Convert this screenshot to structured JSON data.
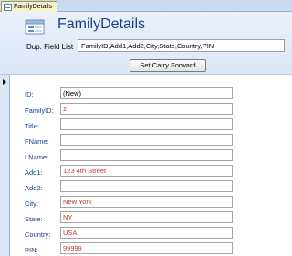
{
  "tab": {
    "label": "FamilyDetails"
  },
  "form": {
    "title": "FamilyDetails"
  },
  "dup_field": {
    "label": "Dup. Field List",
    "value": "FamilyID,Add1,Add2,City,State,Country,PIN"
  },
  "buttons": {
    "carry_forward": "Set Carry Forward"
  },
  "fields": [
    {
      "label": "ID:",
      "value": "(New)"
    },
    {
      "label": "FamilyID:",
      "value": "2"
    },
    {
      "label": "Title:",
      "value": ""
    },
    {
      "label": "FName:",
      "value": ""
    },
    {
      "label": "LName:",
      "value": ""
    },
    {
      "label": "Add1:",
      "value": "123 4th Street"
    },
    {
      "label": "Add2:",
      "value": ""
    },
    {
      "label": "City:",
      "value": "New York"
    },
    {
      "label": "State:",
      "value": "NY"
    },
    {
      "label": "Country:",
      "value": "USA"
    },
    {
      "label": "PIN:",
      "value": "99999"
    }
  ],
  "colors": {
    "label": "#15428b",
    "value_carried": "#c0392b",
    "header_bg": "#dbe7f6"
  },
  "icons": {
    "tab": "form-icon",
    "header": "form-header-icon",
    "record": "current-record-arrow-icon"
  }
}
